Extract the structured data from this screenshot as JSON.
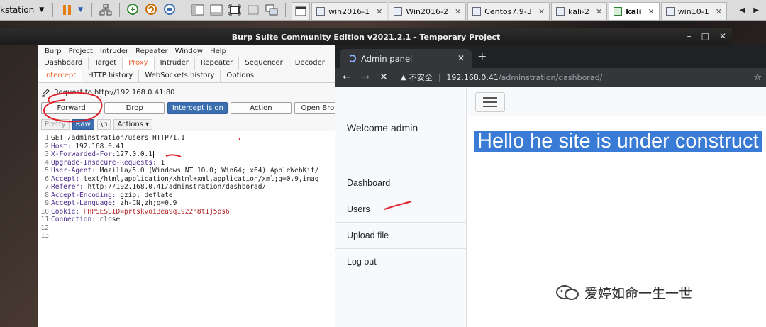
{
  "vmware": {
    "title": "kstation",
    "tabs": [
      {
        "label": "win2016-1",
        "active": false
      },
      {
        "label": "Win2016-2",
        "active": false
      },
      {
        "label": "Centos7.9-3",
        "active": false
      },
      {
        "label": "kali-2",
        "active": false
      },
      {
        "label": "kali",
        "active": true
      },
      {
        "label": "win10-1",
        "active": false
      }
    ],
    "nav_prev": "◀",
    "nav_next": "▶"
  },
  "burp": {
    "window_title": "Burp Suite Community Edition v2021.2.1 - Temporary Project",
    "menu": [
      "Burp",
      "Project",
      "Intruder",
      "Repeater",
      "Window",
      "Help"
    ],
    "tabs": [
      "Dashboard",
      "Target",
      "Proxy",
      "Intruder",
      "Repeater",
      "Sequencer",
      "Decoder"
    ],
    "active_tab": "Proxy",
    "proxy_tabs": [
      "Intercept",
      "HTTP history",
      "WebSockets history",
      "Options"
    ],
    "active_proxy_tab": "Intercept",
    "request_to": "Request to http://192.168.0.41:80",
    "buttons": {
      "forward": "Forward",
      "drop": "Drop",
      "intercept": "Intercept is on",
      "action": "Action",
      "open_browser": "Open Brow"
    },
    "editor_tabs": {
      "pretty": "Pretty",
      "raw": "Raw",
      "newline": "\\n",
      "actions": "Actions"
    },
    "request_lines": [
      {
        "n": "1",
        "key": "",
        "val": "GET /adminstration/users HTTP/1.1"
      },
      {
        "n": "2",
        "key": "Host:",
        "val": " 192.168.0.41"
      },
      {
        "n": "3",
        "key": "X-Forwarded-For:",
        "val": "127.0.0.1"
      },
      {
        "n": "4",
        "key": "Upgrade-Insecure-Requests:",
        "val": " 1"
      },
      {
        "n": "5",
        "key": "User-Agent:",
        "val": " Mozilla/5.0 (Windows NT 10.0; Win64; x64) AppleWebKit/"
      },
      {
        "n": "6",
        "key": "Accept:",
        "val": " text/html,application/xhtml+xml,application/xml;q=0.9,imag"
      },
      {
        "n": "7",
        "key": "Referer:",
        "val": " http://192.168.0.41/adminstration/dashborad/"
      },
      {
        "n": "8",
        "key": "Accept-Encoding:",
        "val": " gzip, deflate"
      },
      {
        "n": "9",
        "key": "Accept-Language:",
        "val": " zh-CN,zh;q=0.9"
      },
      {
        "n": "10",
        "key": "Cookie:",
        "val": " PHPSESSID=prtskvoi3ea9q1922n8t1j5ps6"
      },
      {
        "n": "11",
        "key": "Connection:",
        "val": " close"
      },
      {
        "n": "12",
        "key": "",
        "val": ""
      },
      {
        "n": "13",
        "key": "",
        "val": ""
      }
    ]
  },
  "chrome": {
    "tab_title": "Admin panel",
    "insecure_label": "不安全",
    "url_host": "192.168.0.41",
    "url_path": "/adminstration/dashborad/"
  },
  "page": {
    "welcome": "Welcome admin",
    "nav": [
      "Dashboard",
      "Users",
      "Upload file",
      "Log out"
    ],
    "hello": "Hello he site is under construct"
  },
  "watermark": "爱婷如命一生一世",
  "colors": {
    "burp_accent": "#e8622f",
    "intercept_blue": "#3b6fb0",
    "selection_blue": "#3a7bd5",
    "annotation_red": "#e0202a"
  }
}
